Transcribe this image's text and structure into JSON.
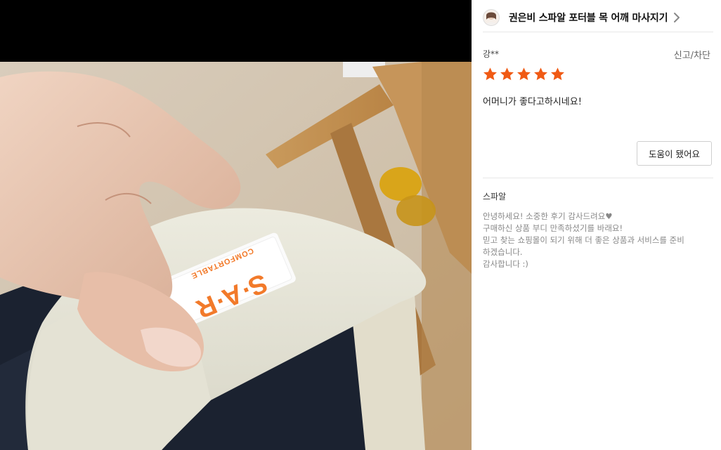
{
  "product": {
    "title": "권은비 스파알 포터블 목 어깨 마사지기"
  },
  "review": {
    "reviewer": "강**",
    "report_label": "신고/차단",
    "rating": 5,
    "rating_max": 5,
    "text": "어머니가 좋다고하시네요!",
    "helpful_label": "도움이 됐어요"
  },
  "seller_reply": {
    "name": "스파알",
    "lines": [
      "안녕하세요! 소중한 후기 감사드려요♥",
      "구매하신 상품 부디 만족하셨기를 바래요!",
      "믿고 찾는 쇼핑몰이 되기 위해 더 좋은 상품과 서비스를 준비",
      "하겠습니다.",
      "감사합니다 :)"
    ]
  },
  "photo": {
    "label_brand": "S·A·R",
    "label_sub": "COMFORTABLE"
  },
  "colors": {
    "star": "#f05a14",
    "label_orange": "#f27a2a"
  },
  "icons": {
    "header_chevron": "chevron-right-icon",
    "star": "star-icon"
  }
}
